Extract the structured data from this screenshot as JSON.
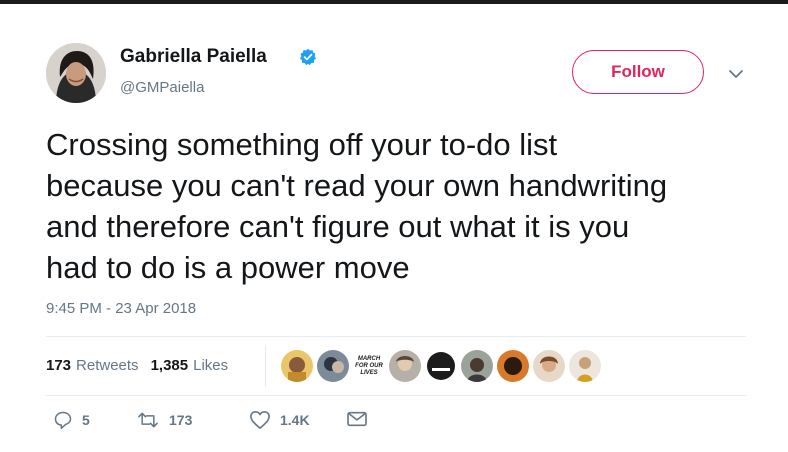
{
  "author": {
    "name": "Gabriella Paiella",
    "handle": "@GMPaiella",
    "verified": true,
    "avatar_icon": "profile-photo"
  },
  "follow_button": {
    "label": "Follow",
    "color": "#e0245e"
  },
  "menu_icon": "chevron-down-icon",
  "tweet": {
    "text": "Crossing something off your to-do list\nbecause you can't read your own handwriting\nand therefore can't figure out what it is you\nhad to do is a power move",
    "timestamp": "9:45 PM - 23 Apr 2018"
  },
  "stats": {
    "retweets_count": "173",
    "retweets_label": "Retweets",
    "likes_count": "1,385",
    "likes_label": "Likes"
  },
  "likers": {
    "count_shown": 9,
    "march_logo_text": [
      "MARCH",
      "FOR OUR",
      "LIVES"
    ]
  },
  "actions": {
    "reply_count": "5",
    "retweet_count": "173",
    "like_count": "1.4K",
    "icons": [
      "reply-icon",
      "retweet-icon",
      "heart-icon",
      "dm-icon"
    ]
  },
  "colors": {
    "text": "#14171a",
    "secondary": "#657786",
    "verified": "#1da1f2",
    "divider": "#e6ecf0"
  }
}
